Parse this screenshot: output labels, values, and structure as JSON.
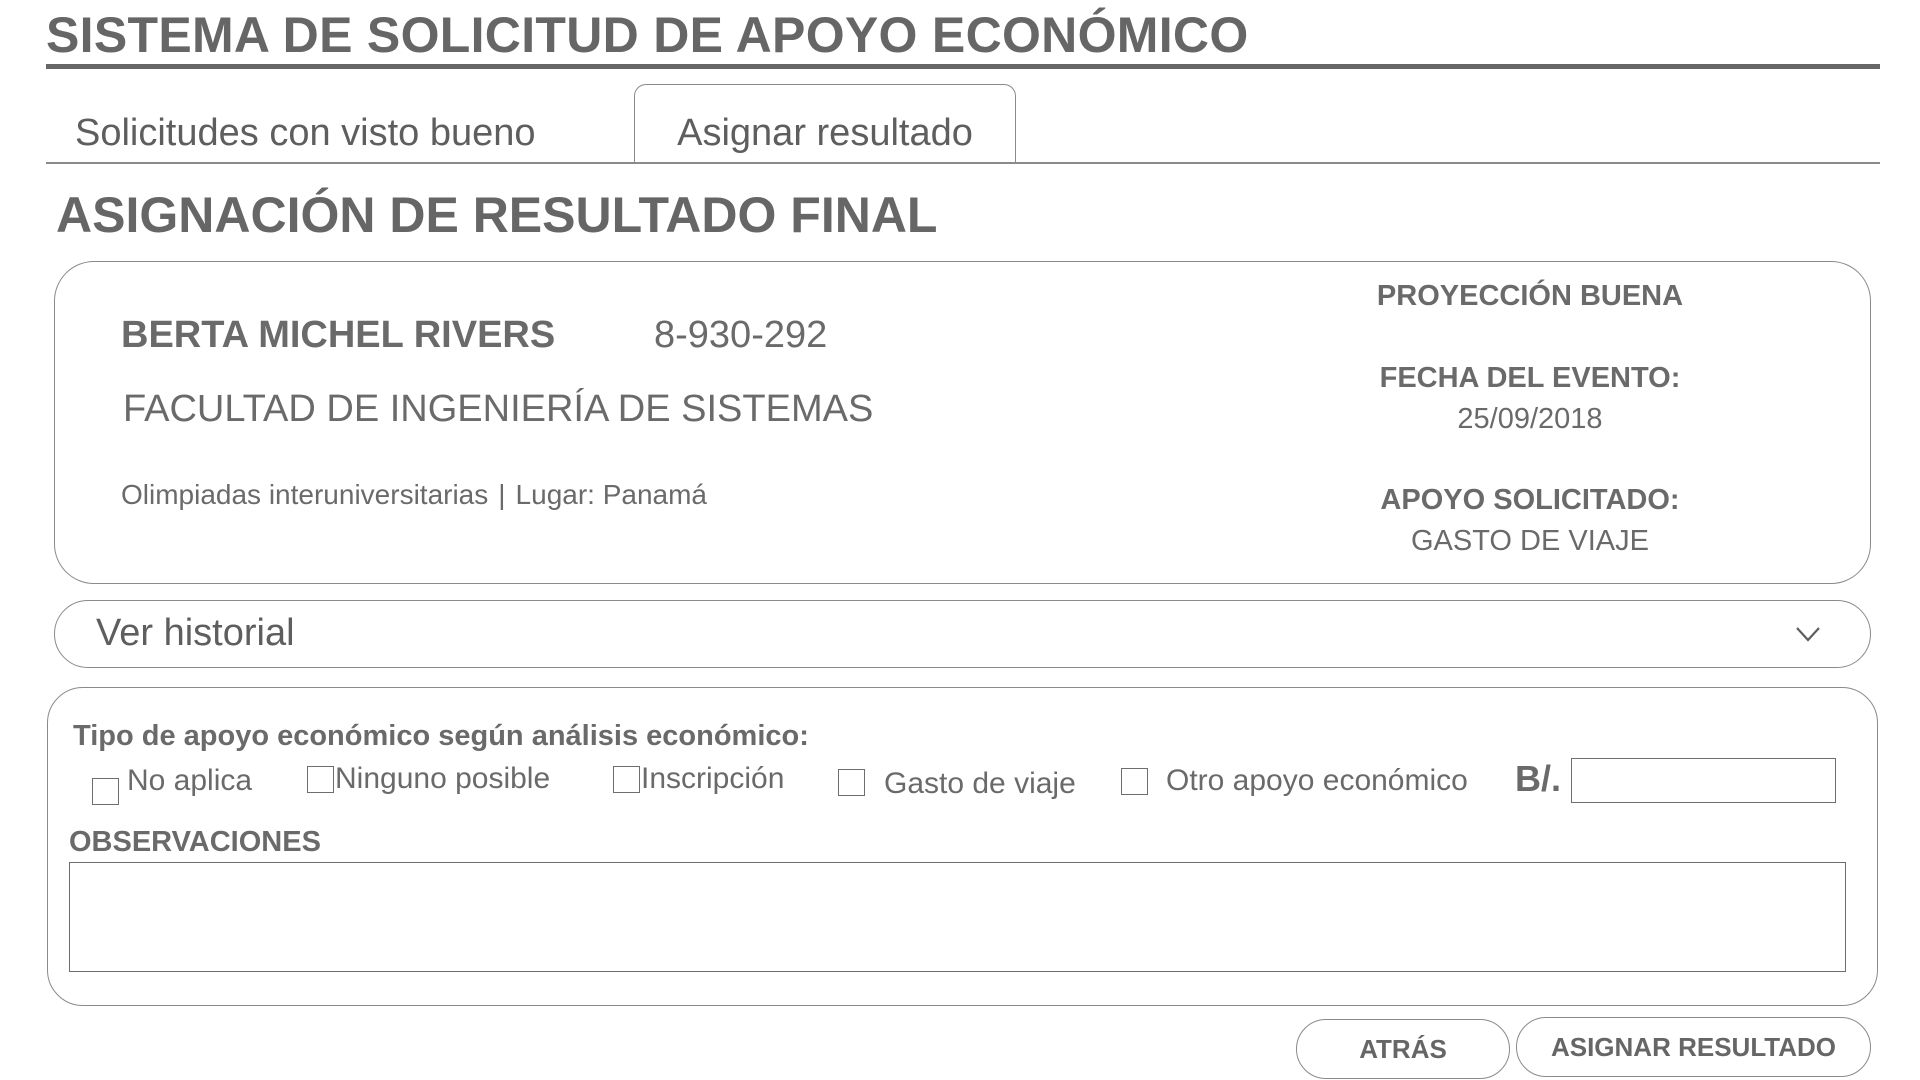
{
  "header": {
    "title": "SISTEMA DE SOLICITUD DE APOYO ECONÓMICO"
  },
  "tabs": [
    {
      "label": "Solicitudes con visto bueno",
      "active": false
    },
    {
      "label": "Asignar resultado",
      "active": true
    }
  ],
  "main": {
    "section_title": "ASIGNACIÓN DE RESULTADO FINAL"
  },
  "applicant": {
    "name": "BERTA MICHEL RIVERS",
    "id_number": "8-930-292",
    "faculty": "FACULTAD DE INGENIERÍA DE SISTEMAS",
    "event": "Olimpiadas interuniversitarias",
    "separator": "|",
    "location": "Lugar: Panamá",
    "projection": "PROYECCIÓN BUENA",
    "event_date_label": "FECHA DEL EVENTO:",
    "event_date": "25/09/2018",
    "requested_support_label": "APOYO SOLICITADO:",
    "requested_support": "GASTO DE VIAJE"
  },
  "history": {
    "label": "Ver historial",
    "icon": "chevron-down-icon"
  },
  "form": {
    "question": "Tipo de apoyo económico según análisis económico:",
    "options": [
      {
        "label": "No aplica",
        "checked": false
      },
      {
        "label": "Ninguno posible",
        "checked": false
      },
      {
        "label": "Inscripción",
        "checked": false
      },
      {
        "label": "Gasto de viaje",
        "checked": false
      },
      {
        "label": "Otro apoyo económico",
        "checked": false
      }
    ],
    "currency_label": "B/.",
    "amount_value": "",
    "observations_label": "OBSERVACIONES",
    "observations_value": ""
  },
  "actions": {
    "back_label": "ATRÁS",
    "assign_label": "ASIGNAR RESULTADO"
  },
  "colors": {
    "text": "#666666",
    "border": "#8a8a8a",
    "background": "#ffffff"
  }
}
